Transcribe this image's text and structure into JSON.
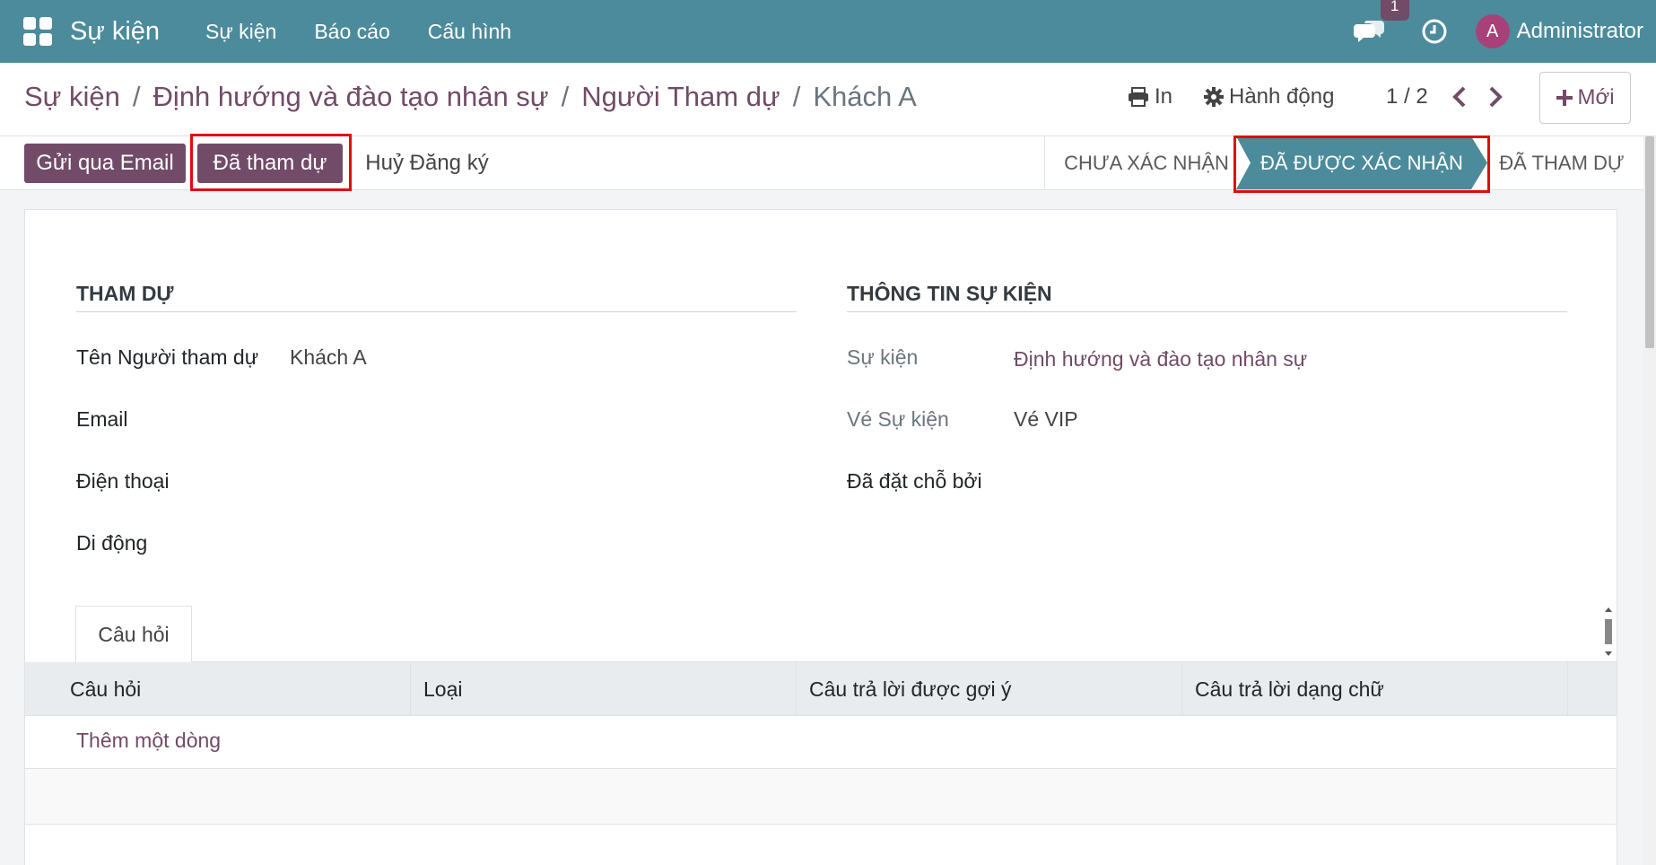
{
  "navbar": {
    "app_title": "Sự kiện",
    "menu": [
      "Sự kiện",
      "Báo cáo",
      "Cấu hình"
    ],
    "chat_count": "1",
    "avatar_initial": "A",
    "user": "Administrator",
    "color": "#4b8b9b"
  },
  "breadcrumb": [
    "Sự kiện",
    "Định hướng và đào tạo nhân sự",
    "Người Tham dự",
    "Khách A"
  ],
  "control_panel": {
    "print_label": "In",
    "action_label": "Hành động",
    "pager": "1 / 2",
    "new_label": "Mới"
  },
  "statusbar": {
    "buttons": [
      "Gửi qua Email",
      "Đã tham dự",
      "Huỷ Đăng ký"
    ],
    "stages": [
      "CHƯA XÁC NHẬN",
      "ĐÃ ĐƯỢC XÁC NHẬN",
      "ĐÃ THAM DỰ"
    ],
    "active_stage": "ĐÃ ĐƯỢC XÁC NHẬN",
    "accent": "#714b67",
    "stage_active_color": "#4b8b9b",
    "highlight_color": "#e20b0b"
  },
  "form": {
    "attendance": {
      "title": "THAM DỰ",
      "fields": [
        {
          "label": "Tên Người tham dự",
          "value": "Khách A"
        },
        {
          "label": "Email",
          "value": ""
        },
        {
          "label": "Điện thoại",
          "value": ""
        },
        {
          "label": "Di động",
          "value": ""
        }
      ]
    },
    "event_info": {
      "title": "THÔNG TIN SỰ KIỆN",
      "fields": [
        {
          "label": "Sự kiện",
          "value": "Định hướng và đào tạo nhân sự"
        },
        {
          "label": "Vé Sự kiện",
          "value": "Vé VIP"
        },
        {
          "label": "Đã đặt chỗ bởi",
          "value": ""
        }
      ]
    }
  },
  "tab": {
    "label": "Câu hỏi",
    "columns": [
      "Câu hỏi",
      "Loại",
      "Câu trả lời được gợi ý",
      "Câu trả lời dạng chữ"
    ],
    "add_line": "Thêm một dòng"
  }
}
